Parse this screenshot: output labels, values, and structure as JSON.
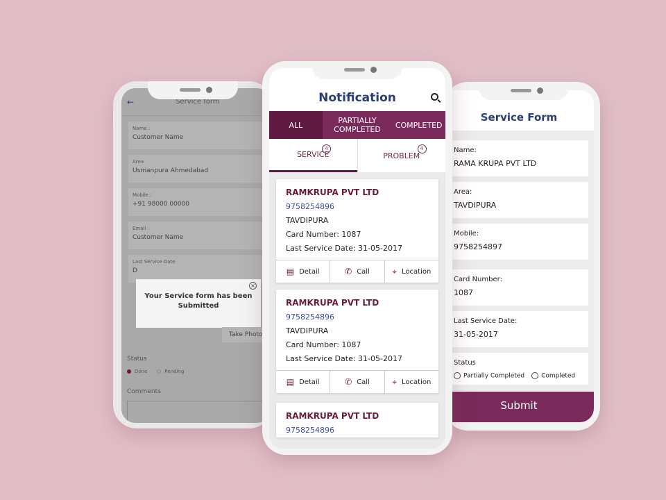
{
  "left_phone": {
    "title": "Service form",
    "fields": [
      {
        "label": "Name :",
        "value": "Customer Name"
      },
      {
        "label": "Area",
        "value": "Usmanpura Ahmedabad"
      },
      {
        "label": "Mobile :",
        "value": "+91 98000 00000"
      },
      {
        "label": "Email :",
        "value": "Customer Name"
      },
      {
        "label": "Last Service Date",
        "value": "D"
      }
    ],
    "popup": "Your Service form has been  Submitted",
    "take_photo": "Take Photo",
    "status_label": "Status",
    "status_options": [
      "Done",
      "Pending"
    ],
    "comments_label": "Comments"
  },
  "middle_phone": {
    "title": "Notification",
    "tabs": [
      "ALL",
      "PARTIALLY COMPLETED",
      "COMPLETED"
    ],
    "subtabs": [
      {
        "label": "SERVICE",
        "count": "4"
      },
      {
        "label": "PROBLEM",
        "count": "4"
      }
    ],
    "cards": [
      {
        "name": "RAMKRUPA PVT LTD",
        "phone": "9758254896",
        "area": "TAVDIPURA",
        "card_number": "Card Number: 1087",
        "last_service": "Last Service Date: 31-05-2017"
      },
      {
        "name": "RAMKRUPA PVT LTD",
        "phone": "9758254896",
        "area": "TAVDIPURA",
        "card_number": "Card Number: 1087",
        "last_service": "Last Service Date: 31-05-2017"
      },
      {
        "name": "RAMKRUPA PVT LTD",
        "phone": "9758254896"
      }
    ],
    "actions": [
      "Detail",
      "Call",
      "Location"
    ]
  },
  "right_phone": {
    "title": "Service Form",
    "fields": [
      {
        "label": "Name:",
        "value": "RAMA KRUPA PVT LTD"
      },
      {
        "label": "Area:",
        "value": "TAVDIPURA"
      },
      {
        "label": "Mobile:",
        "value": "9758254897"
      },
      {
        "label": "Card Number:",
        "value": "1087"
      },
      {
        "label": "Last Service Date:",
        "value": "31-05-2017"
      }
    ],
    "status_label": "Status",
    "status_options": [
      "Partially Completed",
      "Completed"
    ],
    "submit": "Submit"
  },
  "colors": {
    "accent": "#7a2a5a",
    "title": "#2a3f7a",
    "background": "#e2bfc7"
  }
}
